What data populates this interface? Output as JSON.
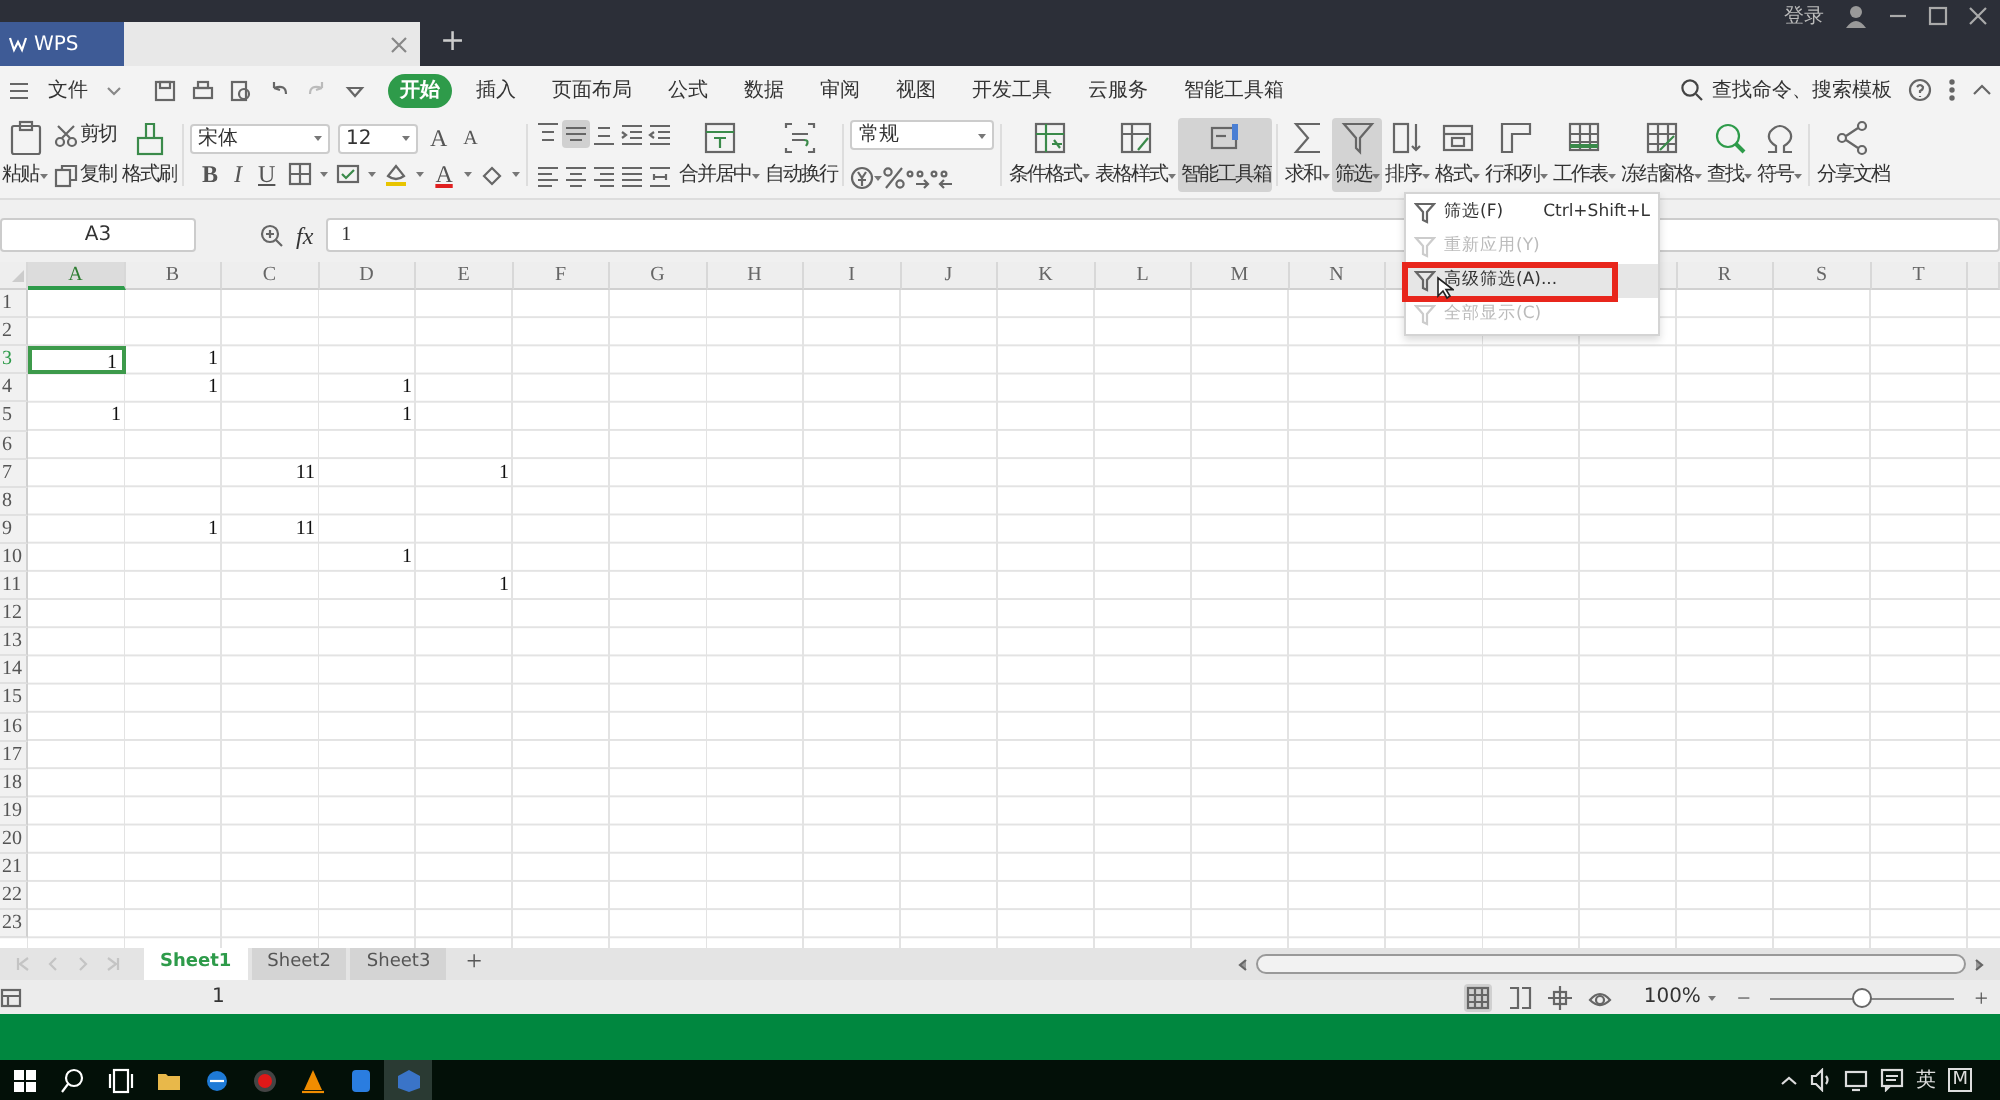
{
  "title_bar": {
    "app_tab": "WPS",
    "new_tab": "+",
    "login": "登录"
  },
  "menu": {
    "file": "文件",
    "tabs": [
      {
        "label": "开始",
        "selected": true
      },
      {
        "label": "插入",
        "selected": false
      },
      {
        "label": "页面布局",
        "selected": false
      },
      {
        "label": "公式",
        "selected": false
      },
      {
        "label": "数据",
        "selected": false
      },
      {
        "label": "审阅",
        "selected": false
      },
      {
        "label": "视图",
        "selected": false
      },
      {
        "label": "开发工具",
        "selected": false
      },
      {
        "label": "云服务",
        "selected": false
      },
      {
        "label": "智能工具箱",
        "selected": false
      }
    ],
    "search_placeholder": "查找命令、搜索模板"
  },
  "ribbon": {
    "paste": {
      "label": "粘贴",
      "has_menu": true
    },
    "cut": "剪切",
    "copy": "复制",
    "format_painter": "格式刷",
    "font": {
      "name": "宋体",
      "size": "12",
      "grow": "A",
      "shrink": "A",
      "bold": "B",
      "italic": "I",
      "underline": "U",
      "font_color": "A"
    },
    "alignment_buttons": [
      {
        "selected": false
      },
      {
        "selected": true
      },
      {
        "selected": false
      },
      {
        "selected": false
      },
      {
        "selected": false
      },
      {
        "selected": false
      },
      {
        "selected": false
      },
      {
        "selected": false
      },
      {
        "selected": false
      },
      {
        "selected": false
      }
    ],
    "merge": {
      "label": "合并居中",
      "has_menu": true
    },
    "wrap": {
      "label": "自动换行",
      "has_menu": false
    },
    "number_format": "常规",
    "tool_groups": [
      {
        "buttons": [
          {
            "label": "条件格式",
            "has_menu": true,
            "selected": false
          },
          {
            "label": "表格样式",
            "has_menu": true,
            "selected": false
          },
          {
            "label": "智能工具箱",
            "has_menu": false,
            "selected": true
          }
        ]
      },
      {
        "buttons": [
          {
            "label": "求和",
            "has_menu": true,
            "selected": false
          },
          {
            "label": "筛选",
            "has_menu": true,
            "selected": true
          },
          {
            "label": "排序",
            "has_menu": true,
            "selected": false
          },
          {
            "label": "格式",
            "has_menu": true,
            "selected": false
          },
          {
            "label": "行和列",
            "has_menu": true,
            "selected": false
          },
          {
            "label": "工作表",
            "has_menu": true,
            "selected": false
          },
          {
            "label": "冻结窗格",
            "has_menu": true,
            "selected": false
          },
          {
            "label": "查找",
            "has_menu": true,
            "selected": false
          },
          {
            "label": "符号",
            "has_menu": true,
            "selected": false
          }
        ]
      },
      {
        "buttons": [
          {
            "label": "分享文档",
            "has_menu": false,
            "selected": false
          }
        ]
      }
    ]
  },
  "filter_menu": {
    "items": [
      {
        "label": "筛选(F)",
        "shortcut": "Ctrl+Shift+L",
        "disabled": false,
        "selected": false,
        "annotated": false
      },
      {
        "label": "重新应用(Y)",
        "disabled": true,
        "selected": false,
        "annotated": false
      },
      {
        "label": "高级筛选(A)...",
        "disabled": false,
        "selected": true,
        "annotated": true
      },
      {
        "label": "全部显示(C)",
        "disabled": true,
        "selected": false,
        "annotated": false
      }
    ]
  },
  "formula_bar": {
    "name_box": "A3",
    "fx": "fx",
    "formula": "1"
  },
  "sheet": {
    "columns_left": [
      "A",
      "B",
      "C",
      "D",
      "E",
      "F",
      "G",
      "H",
      "I",
      "J",
      "K",
      "L",
      "M",
      "N"
    ],
    "columns_right": [
      "R",
      "S",
      "T"
    ],
    "rows": [
      {
        "header": "1",
        "cells": []
      },
      {
        "header": "2",
        "cells": []
      },
      {
        "header": "3",
        "cells": [
          {
            "value": "1",
            "selected": true
          },
          {
            "value": "1",
            "selected": false
          }
        ]
      },
      {
        "header": "4",
        "cells": [
          {
            "selected": false
          },
          {
            "value": "1",
            "selected": false
          },
          {
            "selected": false
          },
          {
            "value": "1",
            "selected": false
          }
        ]
      },
      {
        "header": "5",
        "cells": [
          {
            "value": "1",
            "selected": false
          },
          {
            "selected": false
          },
          {
            "selected": false
          },
          {
            "value": "1",
            "selected": false
          }
        ]
      },
      {
        "header": "6",
        "cells": []
      },
      {
        "header": "7",
        "cells": [
          {
            "selected": false
          },
          {
            "selected": false
          },
          {
            "value": "11",
            "selected": false
          },
          {
            "selected": false
          },
          {
            "value": "1",
            "selected": false
          }
        ]
      },
      {
        "header": "8",
        "cells": []
      },
      {
        "header": "9",
        "cells": [
          {
            "selected": false
          },
          {
            "value": "1",
            "selected": false
          },
          {
            "value": "11",
            "selected": false
          }
        ]
      },
      {
        "header": "10",
        "cells": [
          {
            "selected": false
          },
          {
            "selected": false
          },
          {
            "selected": false
          },
          {
            "value": "1",
            "selected": false
          }
        ]
      },
      {
        "header": "11",
        "cells": [
          {
            "selected": false
          },
          {
            "selected": false
          },
          {
            "selected": false
          },
          {
            "selected": false
          },
          {
            "value": "1",
            "selected": false
          }
        ]
      },
      {
        "header": "12",
        "cells": []
      },
      {
        "header": "13",
        "cells": []
      },
      {
        "header": "14",
        "cells": []
      },
      {
        "header": "15",
        "cells": []
      },
      {
        "header": "16",
        "cells": []
      },
      {
        "header": "17",
        "cells": []
      },
      {
        "header": "18",
        "cells": []
      },
      {
        "header": "19",
        "cells": []
      },
      {
        "header": "20",
        "cells": []
      },
      {
        "header": "21",
        "cells": []
      },
      {
        "header": "22",
        "cells": []
      },
      {
        "header": "23",
        "cells": []
      }
    ],
    "tabs": [
      {
        "label": "Sheet1",
        "selected": true
      },
      {
        "label": "Sheet2",
        "selected": false
      },
      {
        "label": "Sheet3",
        "selected": false
      }
    ],
    "add_sheet": "+"
  },
  "status_bar": {
    "value": "1",
    "zoom": "100%",
    "zoom_minus": "−",
    "zoom_plus": "+",
    "zoom_slider": {
      "level": 0.5
    }
  },
  "taskbar": {
    "tray_texts": [
      "英",
      "M"
    ]
  }
}
